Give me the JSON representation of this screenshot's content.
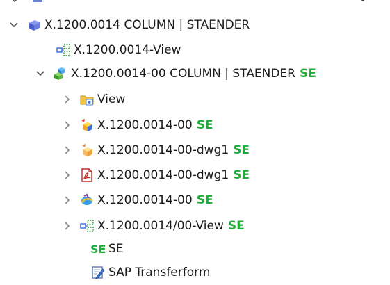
{
  "tree": {
    "top_row": {
      "label": ""
    },
    "root": {
      "label": "X.1200.0014 COLUMN | STAENDER",
      "icon": "part-cube-icon",
      "expanded": true
    },
    "view_link": {
      "label": "X.1200.0014-View",
      "icon": "view-link-icon"
    },
    "assembly": {
      "label": "X.1200.0014-00 COLUMN | STAENDER",
      "badge": "SE",
      "icon": "assembly-icon",
      "expanded": true
    },
    "children": [
      {
        "label": "View",
        "badge": "",
        "icon": "folder-view-icon"
      },
      {
        "label": "X.1200.0014-00",
        "badge": "SE",
        "icon": "part-file-icon"
      },
      {
        "label": "X.1200.0014-00-dwg1",
        "badge": "SE",
        "icon": "drawing-file-icon"
      },
      {
        "label": "X.1200.0014-00-dwg1",
        "badge": "SE",
        "icon": "pdf-icon"
      },
      {
        "label": "X.1200.0014-00",
        "badge": "SE",
        "icon": "jt-file-icon"
      },
      {
        "label": "X.1200.0014/00-View",
        "badge": "SE",
        "icon": "view-link-icon"
      }
    ],
    "se_item": {
      "icon_text": "SE",
      "label": "SE"
    },
    "sap_item": {
      "label": "SAP Transferform",
      "icon": "form-edit-icon"
    }
  },
  "colors": {
    "badge_green": "#1fae3a",
    "twisty": "#555555"
  }
}
